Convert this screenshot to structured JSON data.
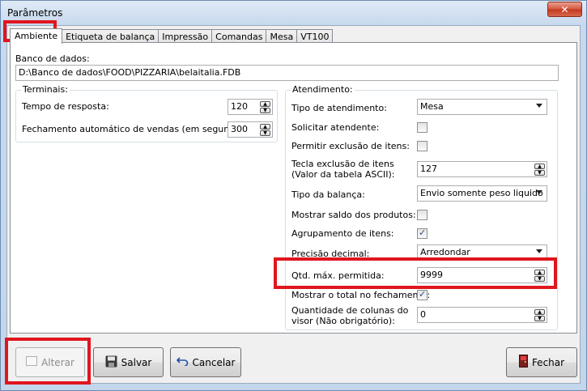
{
  "window": {
    "title": "Parâmetros",
    "close_label": "✕"
  },
  "tabs": [
    "Ambiente",
    "Etiqueta de balança",
    "Impressão",
    "Comandas",
    "Mesa",
    "VT100"
  ],
  "database": {
    "label": "Banco de dados:",
    "value": "D:\\Banco de dados\\FOOD\\PIZZARIA\\belaitalia.FDB"
  },
  "terminais": {
    "title": "Terminais:",
    "tempo_label": "Tempo de resposta:",
    "tempo_value": "120",
    "fechamento_label": "Fechamento automático de vendas (em segundos):",
    "fechamento_value": "300"
  },
  "atendimento": {
    "title": "Atendimento:",
    "tipo_label": "Tipo de atendimento:",
    "tipo_value": "Mesa",
    "solicitar_label": "Solicitar atendente:",
    "solicitar_checked": false,
    "permitir_label": "Permitir exclusão de itens:",
    "permitir_checked": false,
    "tecla_label_1": "Tecla exclusão de itens",
    "tecla_label_2": "(Valor da tabela ASCII):",
    "tecla_value": "127",
    "balanca_label": "Tipo da balança:",
    "balanca_value": "Envio somente peso liquido",
    "saldo_label": "Mostrar saldo dos produtos:",
    "saldo_checked": false,
    "agrup_label": "Agrupamento de itens:",
    "agrup_checked": true,
    "precisao_label": "Precisão decimal:",
    "precisao_value": "Arredondar",
    "qtd_label": "Qtd. máx. permitida:",
    "qtd_value": "9999",
    "total_label": "Mostrar o total no fechamento:",
    "total_checked": true,
    "colunas_label_1": "Quantidade de colunas do",
    "colunas_label_2": "visor (Não obrigatório):",
    "colunas_value": "0"
  },
  "buttons": {
    "alterar": "Alterar",
    "salvar": "Salvar",
    "cancelar": "Cancelar",
    "fechar": "Fechar"
  },
  "colors": {
    "highlight": "#e0161e",
    "title_bar": "#c7d9ee",
    "close": "#c2371c"
  }
}
